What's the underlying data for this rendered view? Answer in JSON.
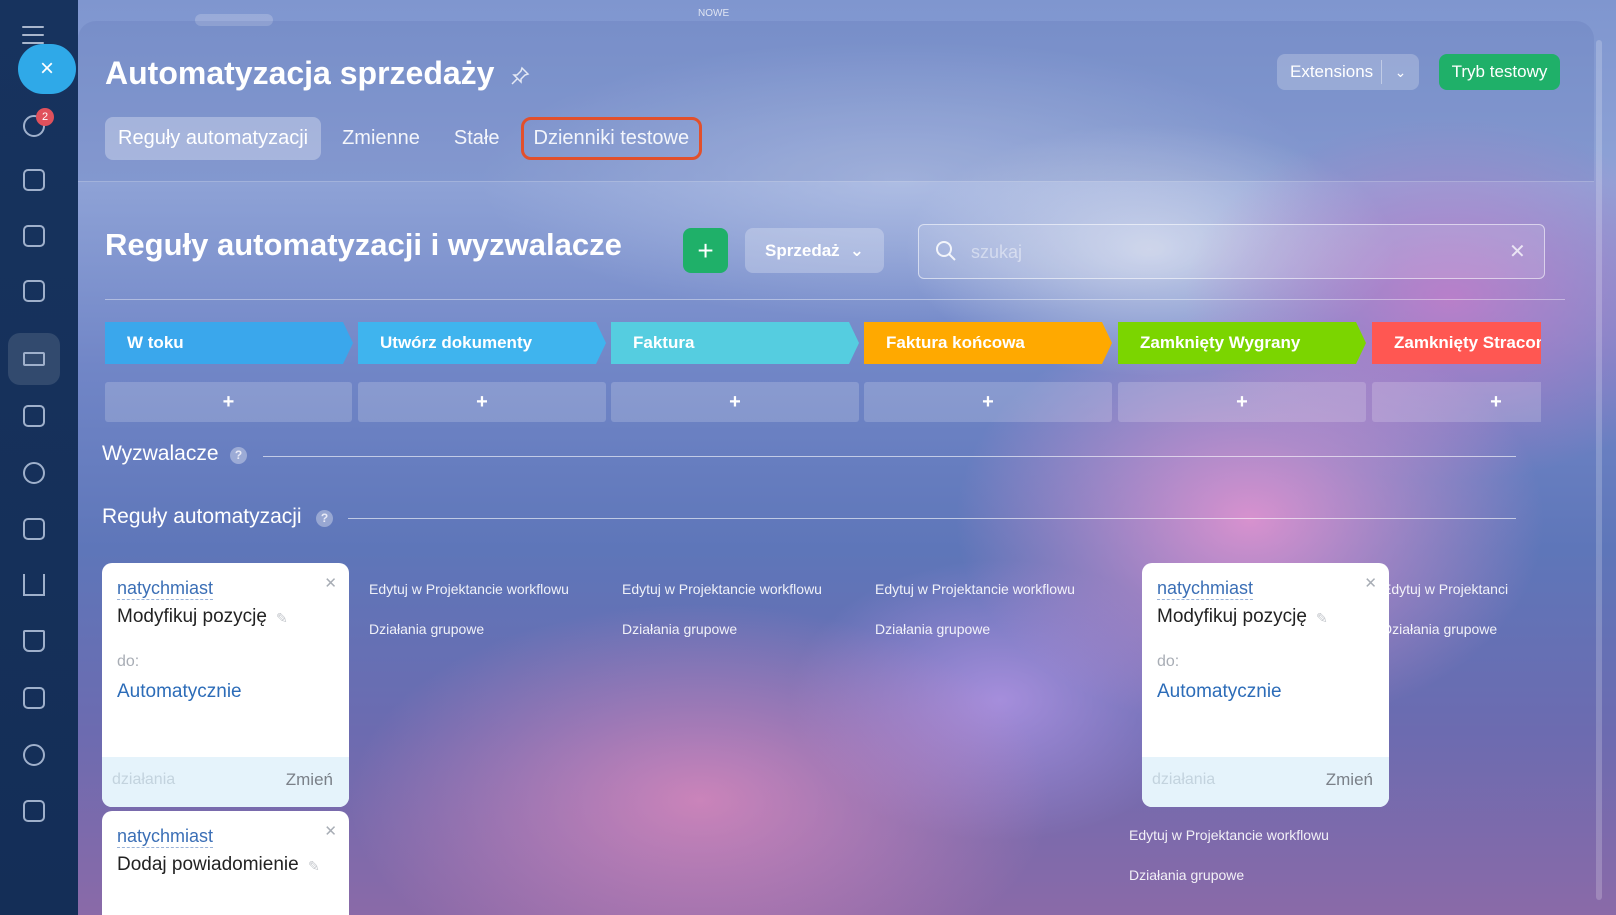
{
  "top": {
    "label": "NOWE"
  },
  "sidebar": {
    "badge": "2"
  },
  "header": {
    "title": "Automatyzacja sprzedaży",
    "extensions_label": "Extensions",
    "test_mode_label": "Tryb testowy",
    "tabs": [
      {
        "label": "Reguły automatyzacji"
      },
      {
        "label": "Zmienne"
      },
      {
        "label": "Stałe"
      },
      {
        "label": "Dzienniki testowe"
      }
    ]
  },
  "section": {
    "title": "Reguły automatyzacji i wyzwalacze",
    "add_label": "+",
    "pipeline_label": "Sprzedaż",
    "search_placeholder": "szukaj"
  },
  "stages": [
    {
      "label": "W toku",
      "color": "#3aa7ec"
    },
    {
      "label": "Utwórz dokumenty",
      "color": "#3fb4ee"
    },
    {
      "label": "Faktura",
      "color": "#55cde0"
    },
    {
      "label": "Faktura końcowa",
      "color": "#ffa900"
    },
    {
      "label": "Zamknięty Wygrany",
      "color": "#7bd500"
    },
    {
      "label": "Zamknięty Stracony",
      "color": "#ff5752"
    }
  ],
  "stage_add_label": "+",
  "triggers_heading": "Wyzwalacze",
  "rules_heading": "Reguły automatyzacji",
  "help_glyph": "?",
  "cards": [
    {
      "trigger": "natychmiast",
      "action": "Modyfikuj pozycję",
      "to_label": "do:",
      "to_value": "Automatycznie",
      "actions_label": "działania",
      "change_label": "Zmień"
    },
    {
      "trigger": "natychmiast",
      "action": "Dodaj powiadomienie"
    },
    {
      "trigger": "natychmiast",
      "action": "Modyfikuj pozycję",
      "to_label": "do:",
      "to_value": "Automatycznie",
      "actions_label": "działania",
      "change_label": "Zmień"
    }
  ],
  "links": {
    "edit_workflow": "Edytuj w Projektancie workflowu",
    "edit_workflow_cut": "Edytuj w Projektanci",
    "group_actions": "Działania grupowe"
  },
  "close_glyph": "×"
}
